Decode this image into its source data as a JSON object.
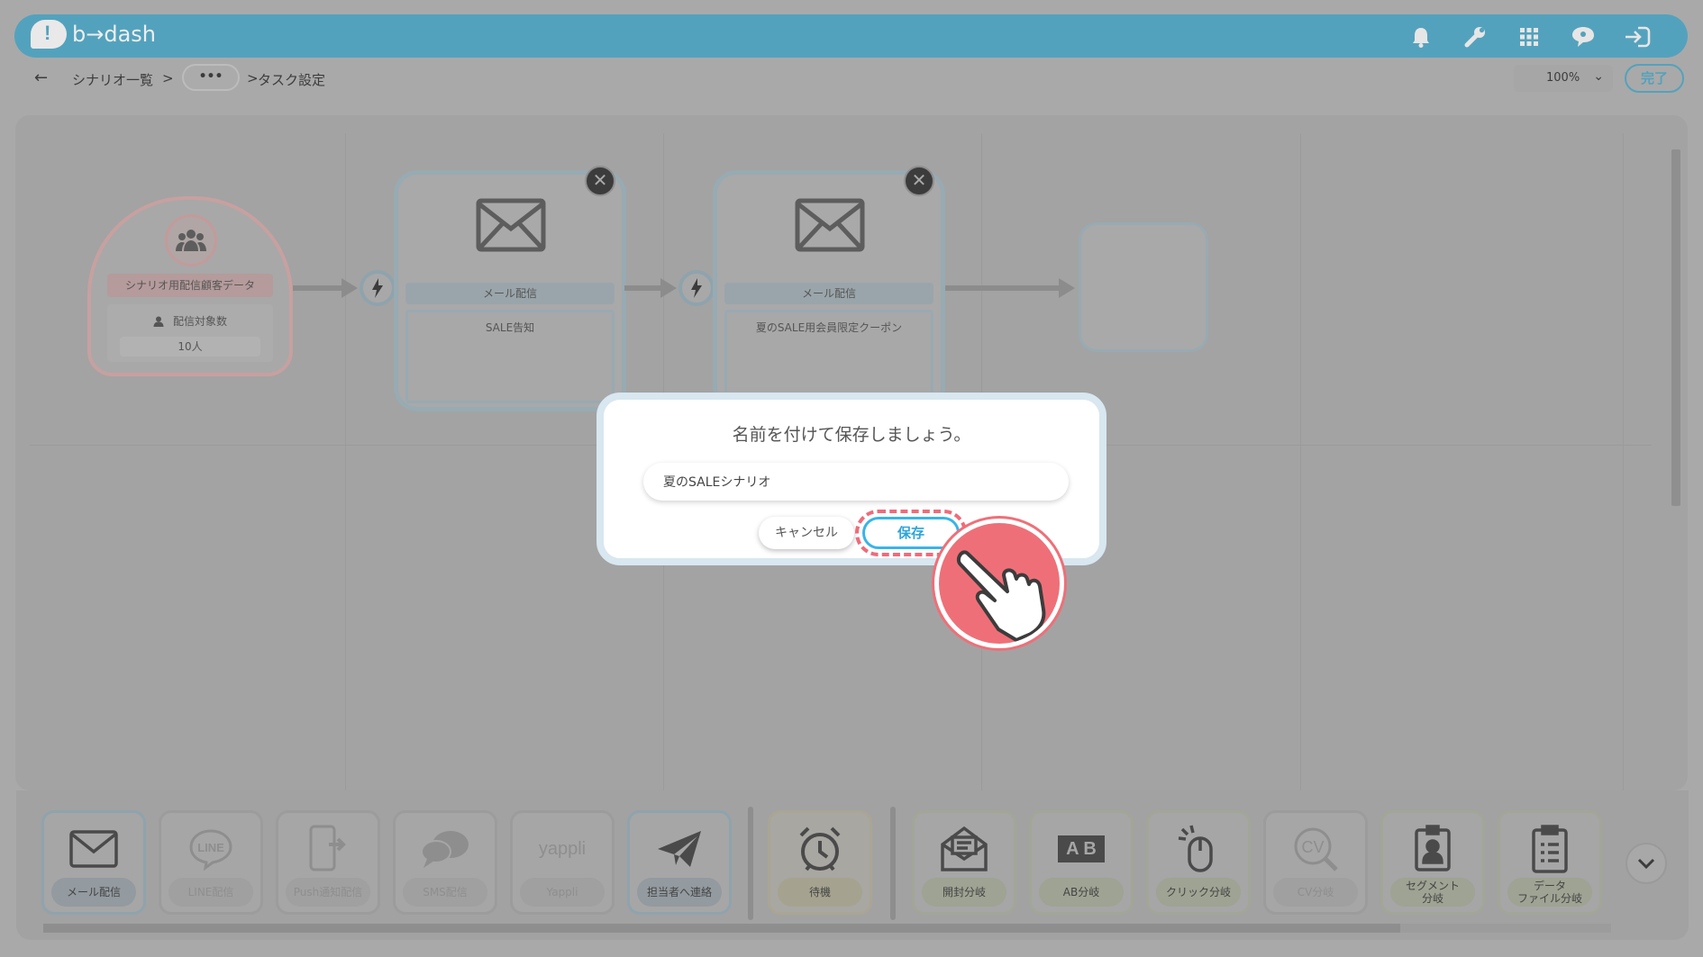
{
  "header": {
    "logo_mark": "!",
    "logo_text": "b→dash",
    "icons": [
      "bell-icon",
      "wrench-icon",
      "apps-grid-icon",
      "user-chat-icon",
      "logout-icon"
    ]
  },
  "breadcrumb": {
    "back": "←",
    "scenario_list": "シナリオ一覧",
    "sep1": ">",
    "ellipsis": "•••",
    "sep2": ">",
    "current": "タスク設定"
  },
  "toolbar": {
    "zoom": "100%",
    "zoom_chevron": "⌄",
    "done_label": "完了"
  },
  "flow": {
    "start_node": {
      "label": "シナリオ用配信顧客データ",
      "sub_label": "配信対象数",
      "count": "10人"
    },
    "mail_nodes": [
      {
        "type_label": "メール配信",
        "title": "SALE告知"
      },
      {
        "type_label": "メール配信",
        "title": "夏のSALE用会員限定クーポン"
      }
    ],
    "close_glyph": "✕"
  },
  "palette": {
    "tools": [
      {
        "label": "メール配信",
        "icon": "envelope-icon",
        "enabled": true
      },
      {
        "label": "LINE配信",
        "icon": "line-icon",
        "enabled": false
      },
      {
        "label": "Push通知配信",
        "icon": "push-phone-icon",
        "enabled": false
      },
      {
        "label": "SMS配信",
        "icon": "sms-bubbles-icon",
        "enabled": false
      },
      {
        "label": "Yappli",
        "icon": "yappli-icon",
        "enabled": false,
        "icon_text": "yappli"
      },
      {
        "label": "担当者へ連絡",
        "icon": "paper-plane-icon",
        "enabled": true
      },
      {
        "label": "待機",
        "icon": "alarm-clock-icon",
        "enabled": true
      },
      {
        "label": "開封分岐",
        "icon": "open-mail-icon",
        "enabled": true
      },
      {
        "label": "AB分岐",
        "icon": "ab-test-icon",
        "enabled": true,
        "icon_text": "A B"
      },
      {
        "label": "クリック分岐",
        "icon": "mouse-click-icon",
        "enabled": true
      },
      {
        "label": "CV分岐",
        "icon": "cv-icon",
        "enabled": false,
        "icon_text": "CV"
      },
      {
        "label_line1": "セグメント",
        "label_line2": "分岐",
        "icon": "segment-badge-icon",
        "enabled": true
      },
      {
        "label_line1": "データ",
        "label_line2": "ファイル分岐",
        "icon": "clipboard-list-icon",
        "enabled": true
      }
    ],
    "line_icon_text": "LINE"
  },
  "dialog": {
    "title": "名前を付けて保存しましょう。",
    "input_value": "夏のSALEシナリオ",
    "cancel_label": "キャンセル",
    "save_label": "保存"
  },
  "colors": {
    "header": "#53a2bd",
    "accent": "#2da5da",
    "highlight": "#ef6b7a",
    "overlay": "#a9a9a9"
  }
}
